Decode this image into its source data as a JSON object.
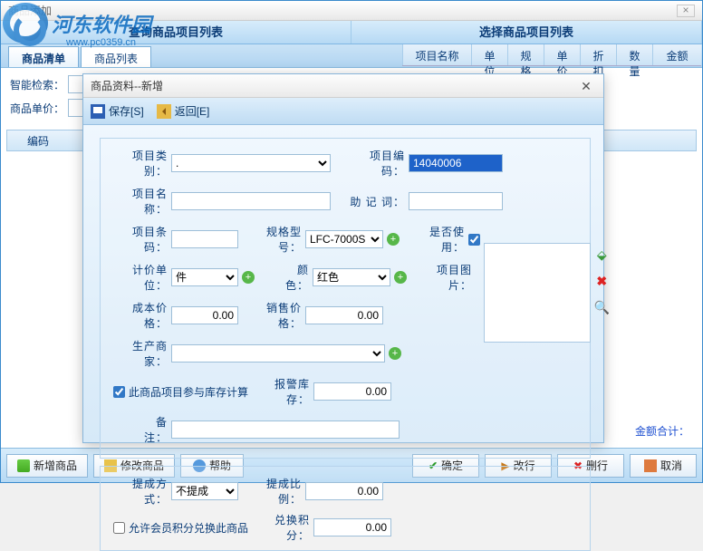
{
  "main_window": {
    "title": "商品添加",
    "close": "×"
  },
  "watermark": {
    "text": "河东软件园",
    "sub": "www.pc0359.cn"
  },
  "panels": {
    "left": "查询商品项目列表",
    "right": "选择商品项目列表"
  },
  "tabs": {
    "list": "商品清单",
    "items": "商品列表"
  },
  "right_cols": [
    "项目名称",
    "单位",
    "规格",
    "单价",
    "折扣",
    "数量",
    "金额"
  ],
  "search": {
    "smart_label": "智能检索：",
    "price_label": "商品单价：",
    "col_code": "编码"
  },
  "footer": {
    "sum_label": "金额合计："
  },
  "buttons": {
    "new": "新增商品",
    "edit": "修改商品",
    "help": "帮助",
    "ok": "确定",
    "modify": "改行",
    "del": "删行",
    "cancel": "取消"
  },
  "dialog": {
    "title": "商品资料--新增",
    "save": "保存[S]",
    "back": "返回[E]",
    "f_category": "项目类别：",
    "f_category_val": ".",
    "f_code": "项目编码：",
    "f_code_val": "14040006",
    "f_name": "项目名称：",
    "f_mnemonic": "助 记 词：",
    "f_barcode": "项目条码：",
    "f_spec": "规格型号：",
    "f_spec_val": "LFC-7000S",
    "f_enable": "是否使用：",
    "f_unit": "计价单位：",
    "f_unit_val": "件",
    "f_color": "颜　　色：",
    "f_color_val": "红色",
    "f_image": "项目图片：",
    "f_cost": "成本价格：",
    "f_cost_val": "0.00",
    "f_sale": "销售价格：",
    "f_sale_val": "0.00",
    "f_maker": "生产商家：",
    "f_stockcalc": "此商品项目参与库存计算",
    "f_alarm": "报警库存：",
    "f_alarm_val": "0.00",
    "f_remark": "备　　注：",
    "f_commission": "提成方式：",
    "f_commission_val": "不提成",
    "f_ratio": "提成比例：",
    "f_ratio_val": "0.00",
    "f_points": "允许会员积分兑换此商品",
    "f_points_val_label": "兑换积分：",
    "f_points_val": "0.00"
  }
}
